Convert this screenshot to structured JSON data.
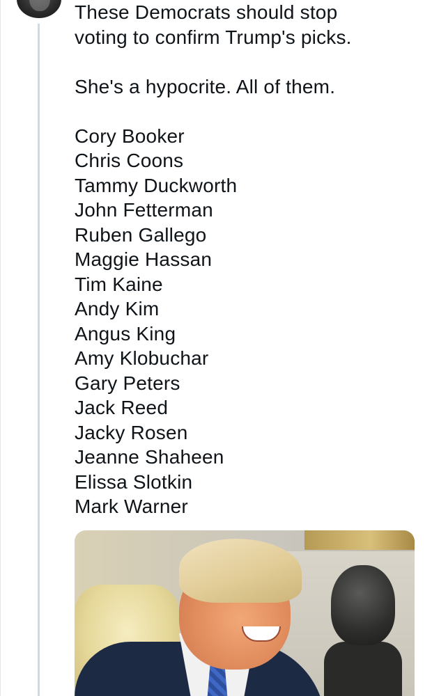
{
  "post": {
    "lines_top": [
      "These Democrats should stop",
      "voting to confirm Trump's picks."
    ],
    "line_middle": "She's a hypocrite. All of them.",
    "names": [
      "Cory Booker",
      "Chris Coons",
      "Tammy Duckworth",
      "John Fetterman",
      "Ruben Gallego",
      "Maggie Hassan",
      "Tim Kaine",
      "Andy Kim",
      "Angus King",
      "Amy Klobuchar",
      "Gary Peters",
      "Jack Reed",
      "Jacky Rosen",
      "Jeanne Shaheen",
      "Elissa Slotkin",
      "Mark Warner"
    ]
  },
  "colors": {
    "text": "#0f1419",
    "thread_line": "#cfd9de",
    "background": "#ffffff"
  },
  "icons": {
    "avatar": "user-avatar"
  }
}
